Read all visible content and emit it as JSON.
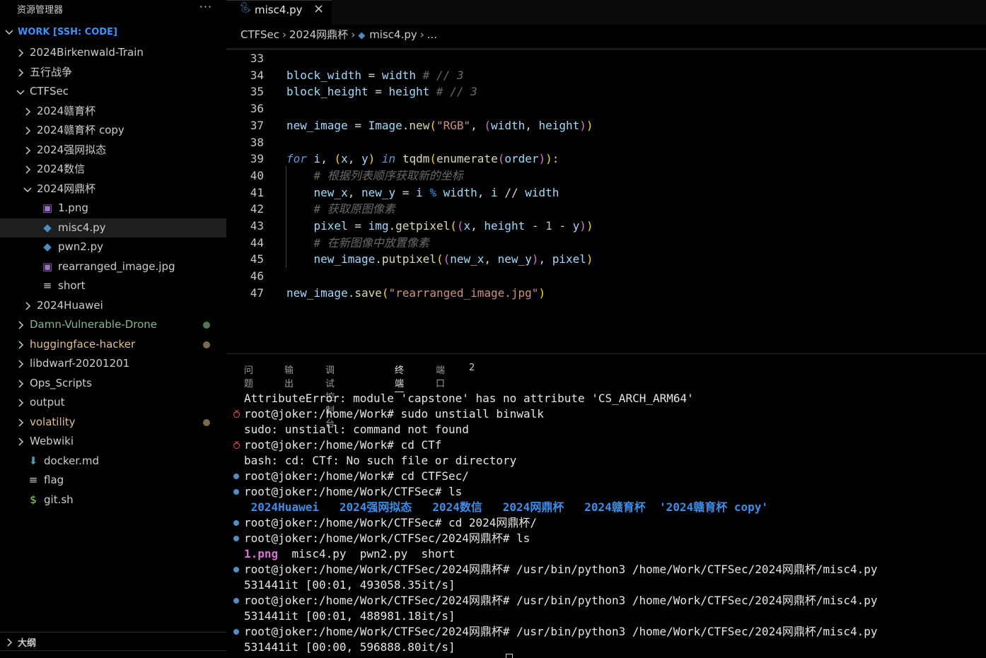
{
  "sidebar": {
    "title": "资源管理器",
    "more_label": "···",
    "workspace_label": "WORK [SSH: CODE]",
    "tree": [
      {
        "label": "2024Birkenwald-Train",
        "depth": 0,
        "type": "folder",
        "expanded": false,
        "color": "#cccccc"
      },
      {
        "label": "五行战争",
        "depth": 0,
        "type": "folder",
        "expanded": false,
        "color": "#cccccc"
      },
      {
        "label": "CTFSec",
        "depth": 0,
        "type": "folder",
        "expanded": true,
        "color": "#cccccc"
      },
      {
        "label": "2024赣育杯",
        "depth": 1,
        "type": "folder",
        "expanded": false,
        "color": "#cccccc"
      },
      {
        "label": "2024赣育杯 copy",
        "depth": 1,
        "type": "folder",
        "expanded": false,
        "color": "#cccccc"
      },
      {
        "label": "2024强网拟态",
        "depth": 1,
        "type": "folder",
        "expanded": false,
        "color": "#cccccc"
      },
      {
        "label": "2024数信",
        "depth": 1,
        "type": "folder",
        "expanded": false,
        "color": "#cccccc"
      },
      {
        "label": "2024网鼎杯",
        "depth": 1,
        "type": "folder",
        "expanded": true,
        "color": "#cccccc"
      },
      {
        "label": "1.png",
        "depth": 2,
        "type": "image",
        "color": "#cccccc"
      },
      {
        "label": "misc4.py",
        "depth": 2,
        "type": "python",
        "color": "#cccccc",
        "selected": true
      },
      {
        "label": "pwn2.py",
        "depth": 2,
        "type": "python",
        "color": "#cccccc"
      },
      {
        "label": "rearranged_image.jpg",
        "depth": 2,
        "type": "image",
        "color": "#cccccc"
      },
      {
        "label": "short",
        "depth": 2,
        "type": "text",
        "color": "#cccccc"
      },
      {
        "label": "2024Huawei",
        "depth": 1,
        "type": "folder",
        "expanded": false,
        "color": "#cccccc"
      },
      {
        "label": "Damn-Vulnerable-Drone",
        "depth": 0,
        "type": "folder",
        "expanded": false,
        "color": "#81b88b",
        "dot": "#4d7a4f"
      },
      {
        "label": "huggingface-hacker",
        "depth": 0,
        "type": "folder",
        "expanded": false,
        "color": "#e2c08d",
        "dot": "#7a6a4a"
      },
      {
        "label": "libdwarf-20201201",
        "depth": 0,
        "type": "folder",
        "expanded": false,
        "color": "#cccccc"
      },
      {
        "label": "Ops_Scripts",
        "depth": 0,
        "type": "folder",
        "expanded": false,
        "color": "#cccccc"
      },
      {
        "label": "output",
        "depth": 0,
        "type": "folder",
        "expanded": false,
        "color": "#cccccc"
      },
      {
        "label": "volatility",
        "depth": 0,
        "type": "folder",
        "expanded": false,
        "color": "#e2c08d",
        "dot": "#7a6a4a"
      },
      {
        "label": "Webwiki",
        "depth": 0,
        "type": "folder",
        "expanded": false,
        "color": "#cccccc"
      },
      {
        "label": "docker.md",
        "depth": 0,
        "type": "markdown",
        "color": "#cccccc"
      },
      {
        "label": "flag",
        "depth": 0,
        "type": "text",
        "color": "#cccccc"
      },
      {
        "label": "git.sh",
        "depth": 0,
        "type": "shell",
        "color": "#cccccc"
      }
    ],
    "outline_label": "大纲"
  },
  "editor": {
    "tab": {
      "label": "misc4.py",
      "close_icon": "×"
    },
    "breadcrumb": [
      "CTFSec",
      "2024网鼎杯",
      "misc4.py",
      "..."
    ],
    "colors": {
      "variable": "#9cdcfe",
      "function": "#dcdcaa",
      "string": "#ce9178",
      "keyword": "#569cd6",
      "comment": "#6a6a6a"
    },
    "lines": [
      {
        "num": "33",
        "tokens": []
      },
      {
        "num": "34",
        "tokens": [
          [
            "v",
            "block_width"
          ],
          [
            "o",
            " = "
          ],
          [
            "v",
            "width"
          ],
          [
            "c",
            " # // 3"
          ]
        ]
      },
      {
        "num": "35",
        "tokens": [
          [
            "v",
            "block_height"
          ],
          [
            "o",
            " = "
          ],
          [
            "v",
            "height"
          ],
          [
            "c",
            " # // 3"
          ]
        ]
      },
      {
        "num": "36",
        "tokens": []
      },
      {
        "num": "37",
        "tokens": [
          [
            "v",
            "new_image"
          ],
          [
            "o",
            " = "
          ],
          [
            "v",
            "Image"
          ],
          [
            "o",
            "."
          ],
          [
            "f",
            "new"
          ],
          [
            "b1",
            "("
          ],
          [
            "s",
            "\"RGB\""
          ],
          [
            "o",
            ", "
          ],
          [
            "b2",
            "("
          ],
          [
            "v",
            "width"
          ],
          [
            "o",
            ", "
          ],
          [
            "v",
            "height"
          ],
          [
            "b2",
            ")"
          ],
          [
            "b1",
            ")"
          ]
        ]
      },
      {
        "num": "38",
        "tokens": []
      },
      {
        "num": "39",
        "tokens": [
          [
            "k",
            "for"
          ],
          [
            "o",
            " "
          ],
          [
            "v",
            "i"
          ],
          [
            "o",
            ", "
          ],
          [
            "b1",
            "("
          ],
          [
            "v",
            "x"
          ],
          [
            "o",
            ", "
          ],
          [
            "v",
            "y"
          ],
          [
            "b1",
            ")"
          ],
          [
            "o",
            " "
          ],
          [
            "k",
            "in"
          ],
          [
            "o",
            " "
          ],
          [
            "f",
            "tqdm"
          ],
          [
            "b1",
            "("
          ],
          [
            "f",
            "enumerate"
          ],
          [
            "b2",
            "("
          ],
          [
            "v",
            "order"
          ],
          [
            "b2",
            ")"
          ],
          [
            "b1",
            ")"
          ],
          [
            "o",
            ":"
          ]
        ]
      },
      {
        "num": "40",
        "tokens": [
          [
            "o",
            "    "
          ],
          [
            "c",
            "# 根据列表顺序获取新的坐标"
          ]
        ]
      },
      {
        "num": "41",
        "tokens": [
          [
            "o",
            "    "
          ],
          [
            "v",
            "new_x"
          ],
          [
            "o",
            ", "
          ],
          [
            "v",
            "new_y"
          ],
          [
            "o",
            " = "
          ],
          [
            "v",
            "i"
          ],
          [
            "o",
            " "
          ],
          [
            "b3",
            "%"
          ],
          [
            "o",
            " "
          ],
          [
            "v",
            "width"
          ],
          [
            "o",
            ", "
          ],
          [
            "v",
            "i"
          ],
          [
            "o",
            " // "
          ],
          [
            "v",
            "width"
          ]
        ]
      },
      {
        "num": "42",
        "tokens": [
          [
            "o",
            "    "
          ],
          [
            "c",
            "# 获取原图像素"
          ]
        ]
      },
      {
        "num": "43",
        "tokens": [
          [
            "o",
            "    "
          ],
          [
            "v",
            "pixel"
          ],
          [
            "o",
            " = "
          ],
          [
            "v",
            "img"
          ],
          [
            "o",
            "."
          ],
          [
            "f",
            "getpixel"
          ],
          [
            "b1",
            "("
          ],
          [
            "b2",
            "("
          ],
          [
            "v",
            "x"
          ],
          [
            "o",
            ", "
          ],
          [
            "v",
            "height"
          ],
          [
            "o",
            " - "
          ],
          [
            "n",
            "1"
          ],
          [
            "o",
            " - "
          ],
          [
            "v",
            "y"
          ],
          [
            "b2",
            ")"
          ],
          [
            "b1",
            ")"
          ]
        ]
      },
      {
        "num": "44",
        "tokens": [
          [
            "o",
            "    "
          ],
          [
            "c",
            "# 在新图像中放置像素"
          ]
        ]
      },
      {
        "num": "45",
        "tokens": [
          [
            "o",
            "    "
          ],
          [
            "v",
            "new_image"
          ],
          [
            "o",
            "."
          ],
          [
            "f",
            "putpixel"
          ],
          [
            "b1",
            "("
          ],
          [
            "b2",
            "("
          ],
          [
            "v",
            "new_x"
          ],
          [
            "o",
            ", "
          ],
          [
            "v",
            "new_y"
          ],
          [
            "b2",
            ")"
          ],
          [
            "o",
            ", "
          ],
          [
            "v",
            "pixel"
          ],
          [
            "b1",
            ")"
          ]
        ]
      },
      {
        "num": "46",
        "tokens": []
      },
      {
        "num": "47",
        "tokens": [
          [
            "v",
            "new_image"
          ],
          [
            "o",
            "."
          ],
          [
            "f",
            "save"
          ],
          [
            "b1",
            "("
          ],
          [
            "s",
            "\"rearranged_image.jpg\""
          ],
          [
            "b1",
            ")"
          ]
        ]
      }
    ]
  },
  "panel": {
    "tabs": [
      "问题",
      "输出",
      "调试控制台",
      "终端",
      "端口"
    ],
    "active_tab": "终端",
    "ports_count": "2",
    "terminal": [
      {
        "status": "none",
        "parts": [
          [
            "t",
            "AttributeError: module 'capstone' has no attribute 'CS_ARCH_ARM64'"
          ]
        ]
      },
      {
        "status": "err",
        "parts": [
          [
            "t",
            "root@joker:/home/Work# sudo unstiall binwalk"
          ]
        ]
      },
      {
        "status": "none",
        "parts": [
          [
            "t",
            "sudo: unstiall: command not found"
          ]
        ]
      },
      {
        "status": "err",
        "parts": [
          [
            "t",
            "root@joker:/home/Work# cd CTf"
          ]
        ]
      },
      {
        "status": "none",
        "parts": [
          [
            "t",
            "bash: cd: CTf: No such file or directory"
          ]
        ]
      },
      {
        "status": "ok",
        "parts": [
          [
            "t",
            "root@joker:/home/Work# cd CTFSec/"
          ]
        ]
      },
      {
        "status": "ok",
        "parts": [
          [
            "t",
            "root@joker:/home/Work/CTFSec# ls"
          ]
        ]
      },
      {
        "status": "none",
        "parts": [
          [
            "t",
            " "
          ],
          [
            "dir",
            "2024Huawei"
          ],
          [
            "t",
            "   "
          ],
          [
            "dir",
            "2024强网拟态"
          ],
          [
            "t",
            "   "
          ],
          [
            "dir",
            "2024数信"
          ],
          [
            "t",
            "   "
          ],
          [
            "dir",
            "2024网鼎杯"
          ],
          [
            "t",
            "   "
          ],
          [
            "dir",
            "2024赣育杯"
          ],
          [
            "t",
            "  "
          ],
          [
            "dir",
            "'2024赣育杯 copy'"
          ]
        ]
      },
      {
        "status": "ok",
        "parts": [
          [
            "t",
            "root@joker:/home/Work/CTFSec# cd 2024网鼎杯/"
          ]
        ]
      },
      {
        "status": "ok",
        "parts": [
          [
            "t",
            "root@joker:/home/Work/CTFSec/2024网鼎杯# ls"
          ]
        ]
      },
      {
        "status": "none",
        "parts": [
          [
            "img",
            "1.png"
          ],
          [
            "t",
            "  misc4.py  pwn2.py  short"
          ]
        ]
      },
      {
        "status": "ok",
        "parts": [
          [
            "t",
            "root@joker:/home/Work/CTFSec/2024网鼎杯# /usr/bin/python3 /home/Work/CTFSec/2024网鼎杯/misc4.py"
          ]
        ]
      },
      {
        "status": "none",
        "parts": [
          [
            "t",
            "531441it [00:01, 493058.35it/s]"
          ]
        ]
      },
      {
        "status": "ok",
        "parts": [
          [
            "t",
            "root@joker:/home/Work/CTFSec/2024网鼎杯# /usr/bin/python3 /home/Work/CTFSec/2024网鼎杯/misc4.py"
          ]
        ]
      },
      {
        "status": "none",
        "parts": [
          [
            "t",
            "531441it [00:01, 488981.18it/s]"
          ]
        ]
      },
      {
        "status": "ok",
        "parts": [
          [
            "t",
            "root@joker:/home/Work/CTFSec/2024网鼎杯# /usr/bin/python3 /home/Work/CTFSec/2024网鼎杯/misc4.py"
          ]
        ]
      },
      {
        "status": "none",
        "parts": [
          [
            "t",
            "531441it [00:00, 596888.80it/s]"
          ]
        ]
      }
    ]
  }
}
